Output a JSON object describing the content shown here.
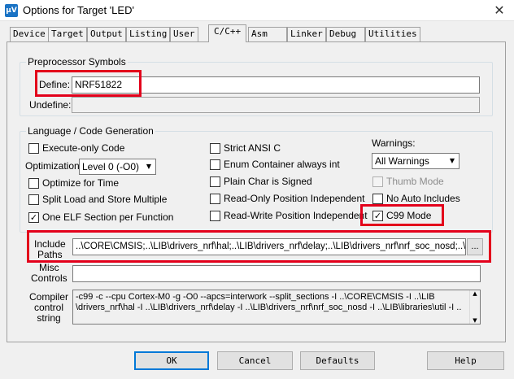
{
  "window": {
    "title": "Options for Target 'LED'",
    "app_icon": "µV",
    "close_glyph": "✕"
  },
  "tabs": [
    "Device",
    "Target",
    "Output",
    "Listing",
    "User",
    "C/C++",
    "Asm",
    "Linker",
    "Debug",
    "Utilities"
  ],
  "active_tab": "C/C++",
  "preprocessor": {
    "title": "Preprocessor Symbols",
    "define_label": "Define:",
    "define_value": "NRF51822",
    "undefine_label": "Undefine:",
    "undefine_value": ""
  },
  "language": {
    "title": "Language / Code Generation",
    "execute_only": {
      "label": "Execute-only Code",
      "checked": false
    },
    "optimization_label": "Optimization:",
    "optimization_value": "Level 0 (-O0)",
    "optimize_time": {
      "label": "Optimize for Time",
      "checked": false
    },
    "split_load": {
      "label": "Split Load and Store Multiple",
      "checked": false
    },
    "one_elf": {
      "label": "One ELF Section per Function",
      "checked": true
    },
    "strict_ansi": {
      "label": "Strict ANSI C",
      "checked": false
    },
    "enum_container": {
      "label": "Enum Container always int",
      "checked": false
    },
    "plain_char": {
      "label": "Plain Char is Signed",
      "checked": false
    },
    "ro_position": {
      "label": "Read-Only Position Independent",
      "checked": false
    },
    "rw_position": {
      "label": "Read-Write Position Independent",
      "checked": false
    },
    "warnings_label": "Warnings:",
    "warnings_value": "All Warnings",
    "thumb_mode": {
      "label": "Thumb Mode",
      "checked": false,
      "disabled": true
    },
    "no_auto_includes": {
      "label": "No Auto Includes",
      "checked": false
    },
    "c99_mode": {
      "label": "C99 Mode",
      "checked": true
    }
  },
  "include": {
    "label_line1": "Include",
    "label_line2": "Paths",
    "value": "..\\CORE\\CMSIS;..\\LIB\\drivers_nrf\\hal;..\\LIB\\drivers_nrf\\delay;..\\LIB\\drivers_nrf\\nrf_soc_nosd;..\\LIB",
    "browse_label": "..."
  },
  "misc": {
    "label_line1": "Misc",
    "label_line2": "Controls",
    "value": ""
  },
  "compiler": {
    "label_line1": "Compiler",
    "label_line2": "control",
    "label_line3": "string",
    "line1": "-c99 -c --cpu Cortex-M0 -g -O0 --apcs=interwork --split_sections -I ..\\CORE\\CMSIS -I ..\\LIB",
    "line2": "\\drivers_nrf\\hal -I ..\\LIB\\drivers_nrf\\delay -I ..\\LIB\\drivers_nrf\\nrf_soc_nosd -I ..\\LIB\\libraries\\util -I .."
  },
  "buttons": {
    "ok": "OK",
    "cancel": "Cancel",
    "defaults": "Defaults",
    "help": "Help"
  },
  "colors": {
    "highlight": "#e3001b",
    "default_button_border": "#0078d7"
  }
}
